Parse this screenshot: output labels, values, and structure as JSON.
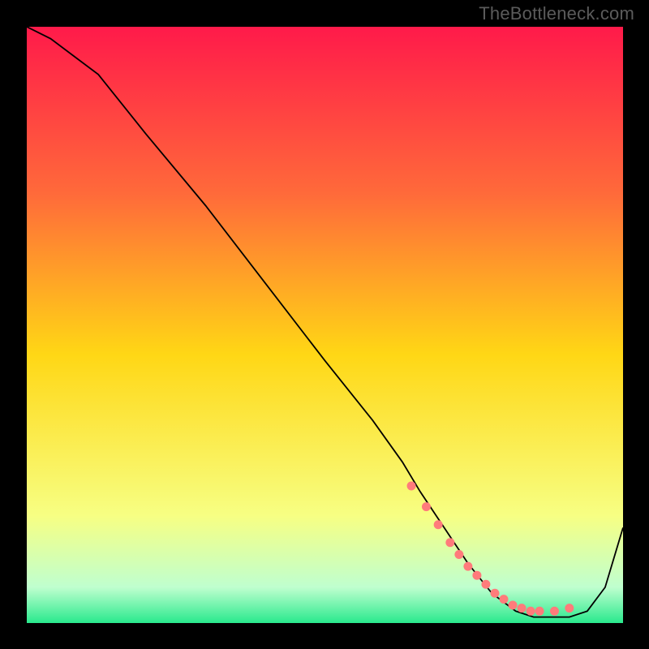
{
  "watermark": "TheBottleneck.com",
  "chart_data": {
    "type": "line",
    "title": "",
    "xlabel": "",
    "ylabel": "",
    "xlim": [
      0,
      100
    ],
    "ylim": [
      0,
      100
    ],
    "background_gradient": {
      "stops": [
        {
          "pos": 0.0,
          "color": "#ff1a4a"
        },
        {
          "pos": 0.28,
          "color": "#ff6a3a"
        },
        {
          "pos": 0.55,
          "color": "#ffd715"
        },
        {
          "pos": 0.82,
          "color": "#f7ff83"
        },
        {
          "pos": 0.94,
          "color": "#bfffcf"
        },
        {
          "pos": 1.0,
          "color": "#29e98d"
        }
      ]
    },
    "series": [
      {
        "name": "curve",
        "stroke": "#000000",
        "stroke_width": 1.8,
        "x": [
          0,
          4,
          8,
          12,
          20,
          30,
          40,
          50,
          58,
          63,
          66,
          70,
          74,
          78,
          82,
          85,
          88,
          91,
          94,
          97,
          100
        ],
        "values": [
          100,
          98,
          95,
          92,
          82,
          70,
          57,
          44,
          34,
          27,
          22,
          16,
          10,
          5,
          2,
          1,
          1,
          1,
          2,
          6,
          16
        ]
      }
    ],
    "markers": {
      "name": "highlight-dots",
      "color": "#ff7b7b",
      "radius": 5.5,
      "x": [
        64.5,
        67.0,
        69.0,
        71.0,
        72.5,
        74.0,
        75.5,
        77.0,
        78.5,
        80.0,
        81.5,
        83.0,
        84.5,
        86.0,
        88.5,
        91.0
      ],
      "values": [
        23.0,
        19.5,
        16.5,
        13.5,
        11.5,
        9.5,
        8.0,
        6.5,
        5.0,
        4.0,
        3.0,
        2.5,
        2.0,
        2.0,
        2.0,
        2.5
      ]
    }
  }
}
